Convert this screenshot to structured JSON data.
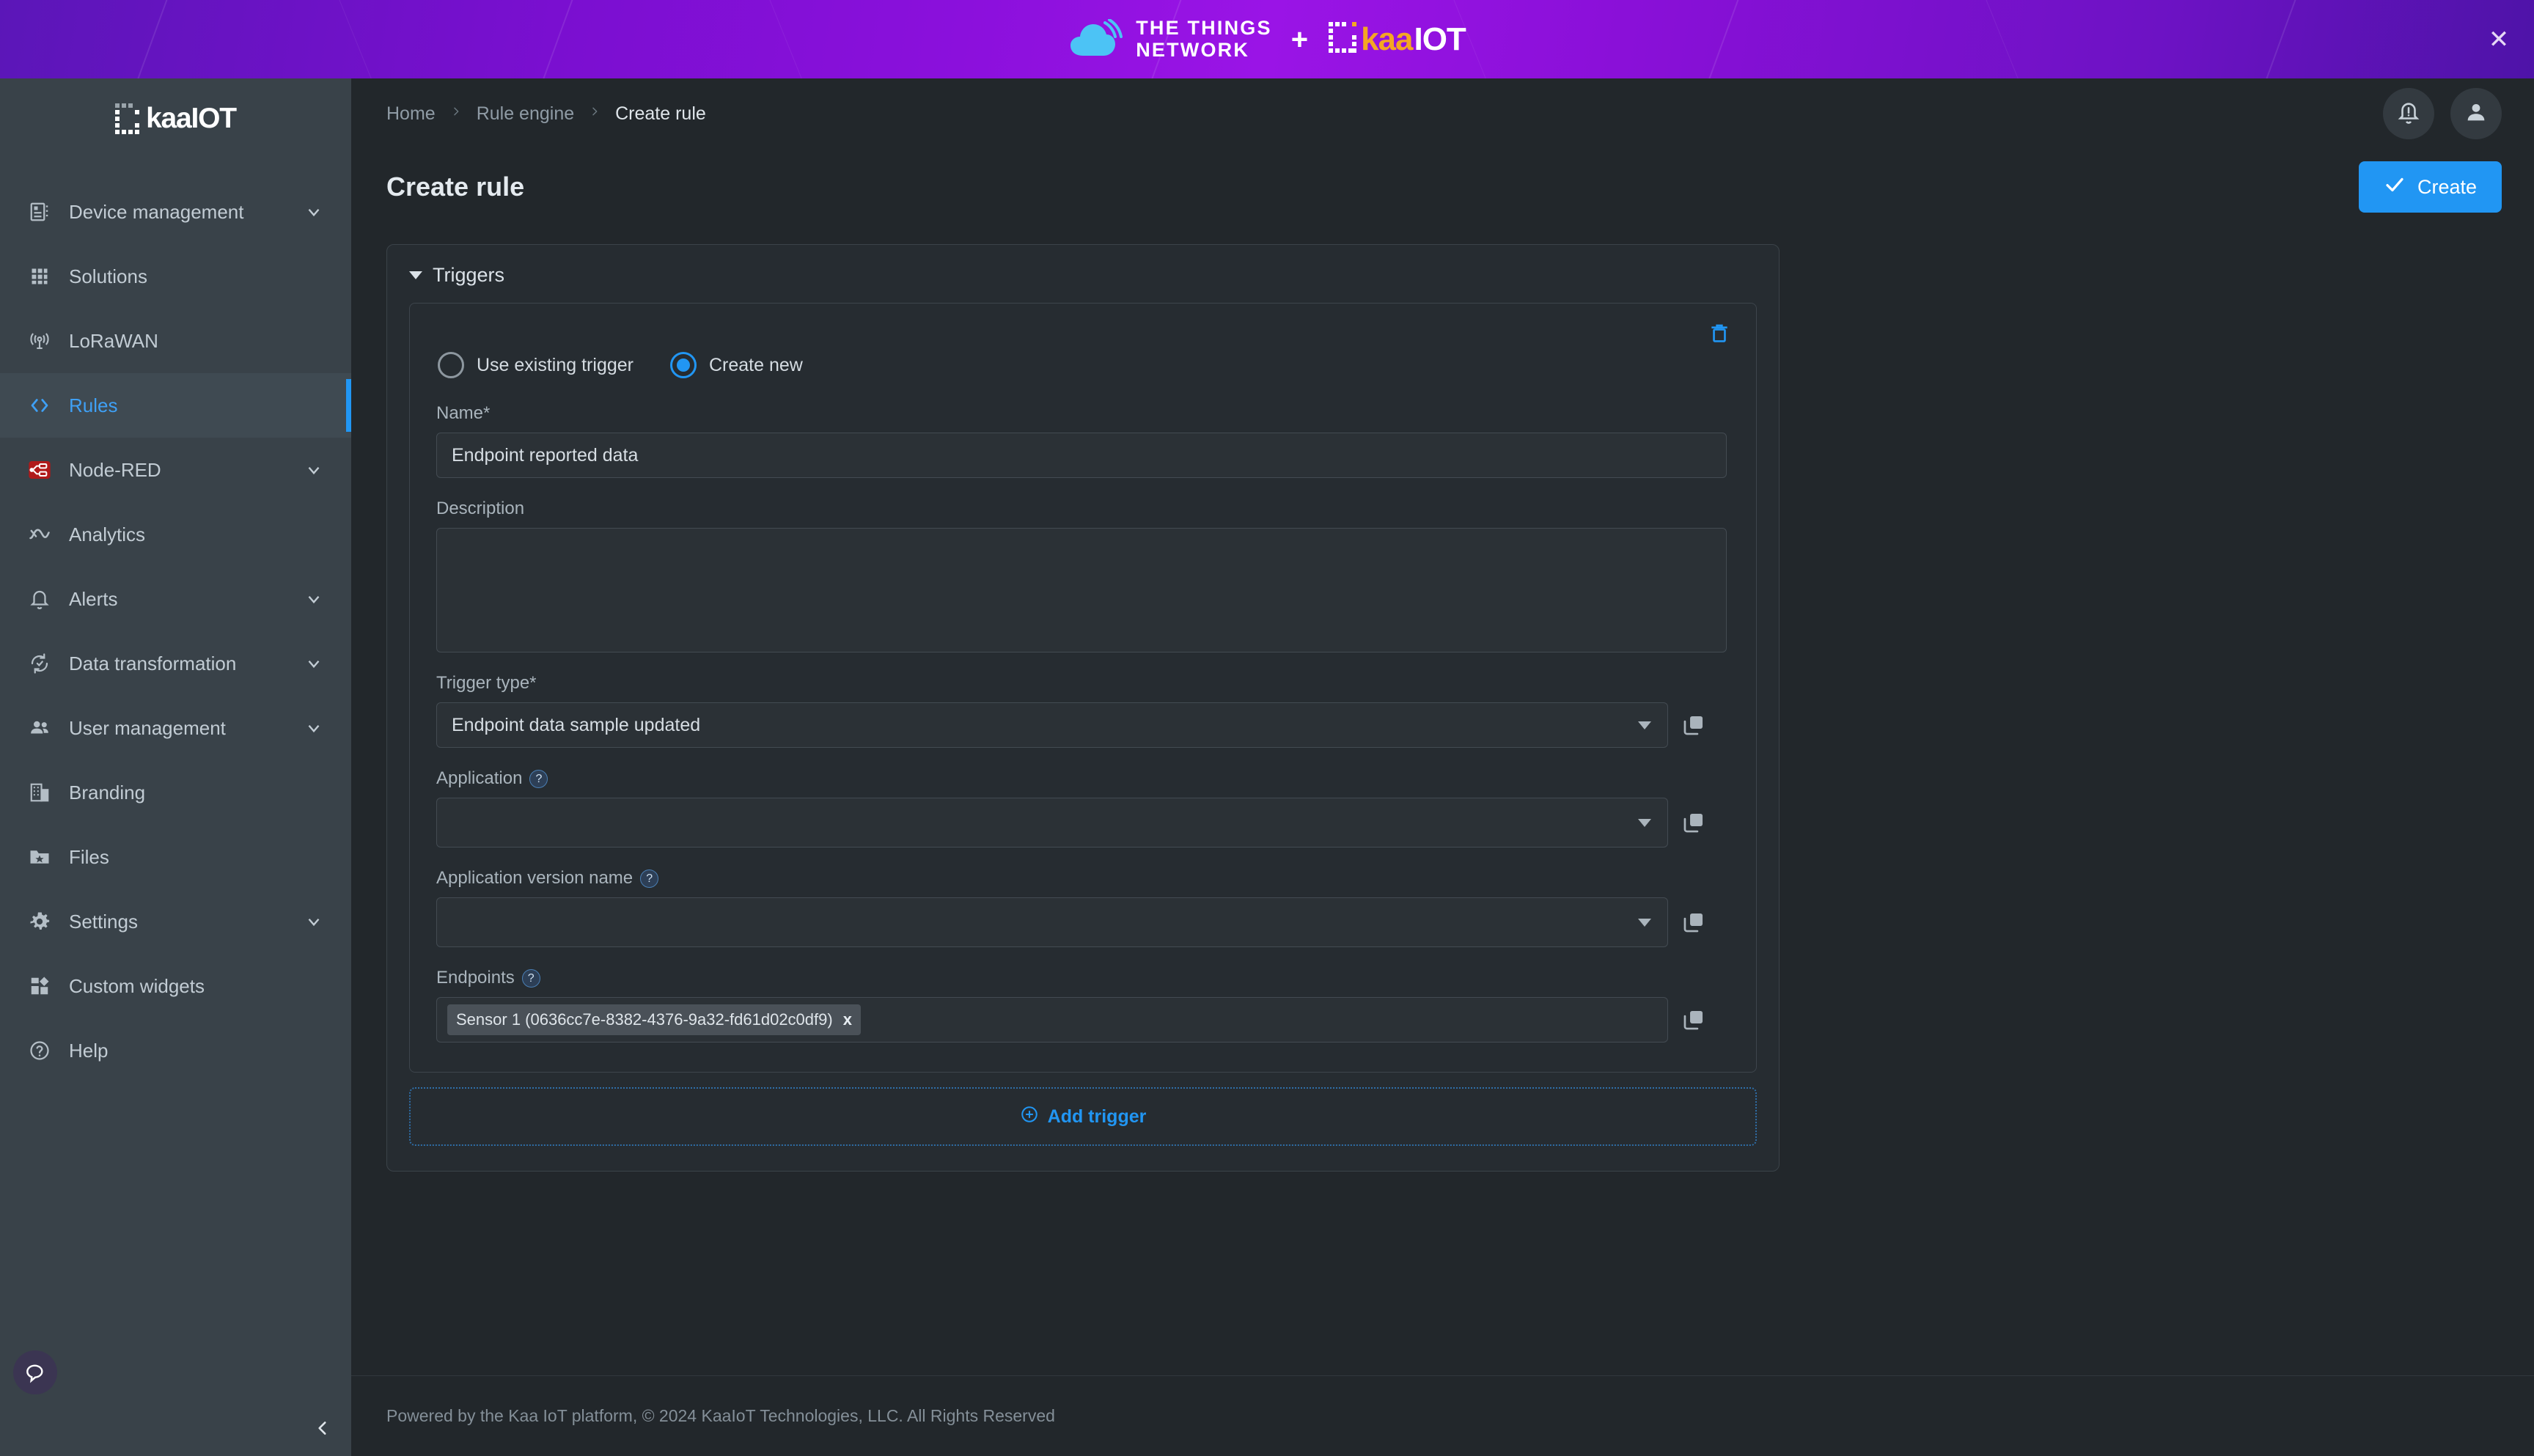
{
  "banner": {
    "ttn_line1": "THE THINGS",
    "ttn_line2": "NETWORK",
    "plus": "+",
    "kaa_orange": "kaa",
    "kaa_white": "IOT",
    "close_label": "✕",
    "background_color": "#8b10dc"
  },
  "sidebar": {
    "brand": "kaaIOT",
    "items": [
      {
        "label": "Device management",
        "icon": "device-chip-icon",
        "expandable": true,
        "active": false
      },
      {
        "label": "Solutions",
        "icon": "grid-apps-icon",
        "expandable": false,
        "active": false
      },
      {
        "label": "LoRaWAN",
        "icon": "antenna-icon",
        "expandable": false,
        "active": false
      },
      {
        "label": "Rules",
        "icon": "code-brackets-icon",
        "expandable": false,
        "active": true
      },
      {
        "label": "Node-RED",
        "icon": "node-red-icon",
        "expandable": true,
        "active": false
      },
      {
        "label": "Analytics",
        "icon": "analytics-chart-icon",
        "expandable": false,
        "active": false
      },
      {
        "label": "Alerts",
        "icon": "bell-icon",
        "expandable": true,
        "active": false
      },
      {
        "label": "Data transformation",
        "icon": "data-sync-icon",
        "expandable": true,
        "active": false
      },
      {
        "label": "User management",
        "icon": "people-icon",
        "expandable": true,
        "active": false
      },
      {
        "label": "Branding",
        "icon": "building-icon",
        "expandable": false,
        "active": false
      },
      {
        "label": "Files",
        "icon": "folder-star-icon",
        "expandable": false,
        "active": false
      },
      {
        "label": "Settings",
        "icon": "gear-icon",
        "expandable": true,
        "active": false
      },
      {
        "label": "Custom widgets",
        "icon": "widgets-icon",
        "expandable": false,
        "active": false
      },
      {
        "label": "Help",
        "icon": "question-circle-icon",
        "expandable": false,
        "active": false
      }
    ],
    "active_accent_color": "#2196f3",
    "chat_icon": "chat-bubble-icon",
    "collapse_icon": "chevron-left-icon"
  },
  "topbar": {
    "breadcrumb": [
      {
        "label": "Home"
      },
      {
        "label": "Rule engine"
      },
      {
        "label": "Create rule"
      }
    ],
    "separator": "›",
    "notifications_icon": "bell-alert-icon",
    "account_icon": "user-avatar-icon"
  },
  "page": {
    "title": "Create rule",
    "create_button": "Create",
    "create_button_icon": "check-icon",
    "accent_color": "#2196f3"
  },
  "triggers_section": {
    "heading": "Triggers",
    "collapse_icon": "caret-down-icon",
    "delete_icon": "trash-icon",
    "radio_options": [
      {
        "label": "Use existing trigger",
        "selected": false
      },
      {
        "label": "Create new",
        "selected": true
      }
    ],
    "fields": {
      "name": {
        "label": "Name*",
        "value": "Endpoint reported data",
        "placeholder": ""
      },
      "description": {
        "label": "Description",
        "value": "",
        "placeholder": ""
      },
      "trigger_type": {
        "label": "Trigger type*",
        "value": "Endpoint data sample updated",
        "copy_icon": "copy-icon"
      },
      "application": {
        "label": "Application",
        "value": "",
        "help": "?",
        "copy_icon": "copy-icon"
      },
      "application_version_name": {
        "label": "Application version name",
        "value": "",
        "help": "?",
        "copy_icon": "copy-icon"
      },
      "endpoints": {
        "label": "Endpoints",
        "help": "?",
        "copy_icon": "copy-icon",
        "chips": [
          {
            "label": "Sensor 1 (0636cc7e-8382-4376-9a32-fd61d02c0df9)",
            "remove": "x"
          }
        ]
      }
    },
    "add_trigger": {
      "label": "Add trigger",
      "icon": "plus-circle-icon"
    }
  },
  "footer": {
    "text": "Powered by the Kaa IoT platform, © 2024 KaaIoT Technologies, LLC. All Rights Reserved"
  }
}
